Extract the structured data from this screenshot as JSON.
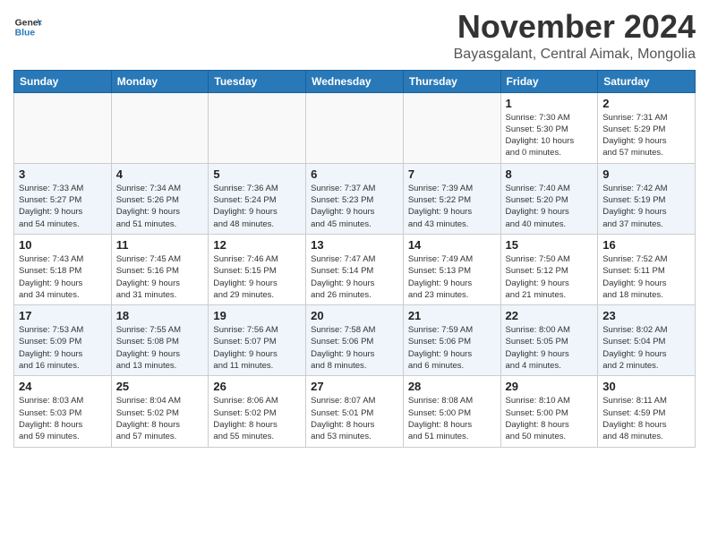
{
  "header": {
    "logo_line1": "General",
    "logo_line2": "Blue",
    "month": "November 2024",
    "location": "Bayasgalant, Central Aimak, Mongolia"
  },
  "weekdays": [
    "Sunday",
    "Monday",
    "Tuesday",
    "Wednesday",
    "Thursday",
    "Friday",
    "Saturday"
  ],
  "weeks": [
    [
      {
        "day": "",
        "info": ""
      },
      {
        "day": "",
        "info": ""
      },
      {
        "day": "",
        "info": ""
      },
      {
        "day": "",
        "info": ""
      },
      {
        "day": "",
        "info": ""
      },
      {
        "day": "1",
        "info": "Sunrise: 7:30 AM\nSunset: 5:30 PM\nDaylight: 10 hours\nand 0 minutes."
      },
      {
        "day": "2",
        "info": "Sunrise: 7:31 AM\nSunset: 5:29 PM\nDaylight: 9 hours\nand 57 minutes."
      }
    ],
    [
      {
        "day": "3",
        "info": "Sunrise: 7:33 AM\nSunset: 5:27 PM\nDaylight: 9 hours\nand 54 minutes."
      },
      {
        "day": "4",
        "info": "Sunrise: 7:34 AM\nSunset: 5:26 PM\nDaylight: 9 hours\nand 51 minutes."
      },
      {
        "day": "5",
        "info": "Sunrise: 7:36 AM\nSunset: 5:24 PM\nDaylight: 9 hours\nand 48 minutes."
      },
      {
        "day": "6",
        "info": "Sunrise: 7:37 AM\nSunset: 5:23 PM\nDaylight: 9 hours\nand 45 minutes."
      },
      {
        "day": "7",
        "info": "Sunrise: 7:39 AM\nSunset: 5:22 PM\nDaylight: 9 hours\nand 43 minutes."
      },
      {
        "day": "8",
        "info": "Sunrise: 7:40 AM\nSunset: 5:20 PM\nDaylight: 9 hours\nand 40 minutes."
      },
      {
        "day": "9",
        "info": "Sunrise: 7:42 AM\nSunset: 5:19 PM\nDaylight: 9 hours\nand 37 minutes."
      }
    ],
    [
      {
        "day": "10",
        "info": "Sunrise: 7:43 AM\nSunset: 5:18 PM\nDaylight: 9 hours\nand 34 minutes."
      },
      {
        "day": "11",
        "info": "Sunrise: 7:45 AM\nSunset: 5:16 PM\nDaylight: 9 hours\nand 31 minutes."
      },
      {
        "day": "12",
        "info": "Sunrise: 7:46 AM\nSunset: 5:15 PM\nDaylight: 9 hours\nand 29 minutes."
      },
      {
        "day": "13",
        "info": "Sunrise: 7:47 AM\nSunset: 5:14 PM\nDaylight: 9 hours\nand 26 minutes."
      },
      {
        "day": "14",
        "info": "Sunrise: 7:49 AM\nSunset: 5:13 PM\nDaylight: 9 hours\nand 23 minutes."
      },
      {
        "day": "15",
        "info": "Sunrise: 7:50 AM\nSunset: 5:12 PM\nDaylight: 9 hours\nand 21 minutes."
      },
      {
        "day": "16",
        "info": "Sunrise: 7:52 AM\nSunset: 5:11 PM\nDaylight: 9 hours\nand 18 minutes."
      }
    ],
    [
      {
        "day": "17",
        "info": "Sunrise: 7:53 AM\nSunset: 5:09 PM\nDaylight: 9 hours\nand 16 minutes."
      },
      {
        "day": "18",
        "info": "Sunrise: 7:55 AM\nSunset: 5:08 PM\nDaylight: 9 hours\nand 13 minutes."
      },
      {
        "day": "19",
        "info": "Sunrise: 7:56 AM\nSunset: 5:07 PM\nDaylight: 9 hours\nand 11 minutes."
      },
      {
        "day": "20",
        "info": "Sunrise: 7:58 AM\nSunset: 5:06 PM\nDaylight: 9 hours\nand 8 minutes."
      },
      {
        "day": "21",
        "info": "Sunrise: 7:59 AM\nSunset: 5:06 PM\nDaylight: 9 hours\nand 6 minutes."
      },
      {
        "day": "22",
        "info": "Sunrise: 8:00 AM\nSunset: 5:05 PM\nDaylight: 9 hours\nand 4 minutes."
      },
      {
        "day": "23",
        "info": "Sunrise: 8:02 AM\nSunset: 5:04 PM\nDaylight: 9 hours\nand 2 minutes."
      }
    ],
    [
      {
        "day": "24",
        "info": "Sunrise: 8:03 AM\nSunset: 5:03 PM\nDaylight: 8 hours\nand 59 minutes."
      },
      {
        "day": "25",
        "info": "Sunrise: 8:04 AM\nSunset: 5:02 PM\nDaylight: 8 hours\nand 57 minutes."
      },
      {
        "day": "26",
        "info": "Sunrise: 8:06 AM\nSunset: 5:02 PM\nDaylight: 8 hours\nand 55 minutes."
      },
      {
        "day": "27",
        "info": "Sunrise: 8:07 AM\nSunset: 5:01 PM\nDaylight: 8 hours\nand 53 minutes."
      },
      {
        "day": "28",
        "info": "Sunrise: 8:08 AM\nSunset: 5:00 PM\nDaylight: 8 hours\nand 51 minutes."
      },
      {
        "day": "29",
        "info": "Sunrise: 8:10 AM\nSunset: 5:00 PM\nDaylight: 8 hours\nand 50 minutes."
      },
      {
        "day": "30",
        "info": "Sunrise: 8:11 AM\nSunset: 4:59 PM\nDaylight: 8 hours\nand 48 minutes."
      }
    ]
  ]
}
